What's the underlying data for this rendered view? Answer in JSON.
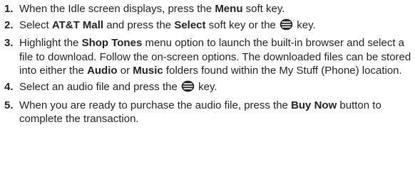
{
  "steps": [
    {
      "number": "1.",
      "t1": "When the Idle screen displays, press the ",
      "b1": "Menu",
      "t2": " soft key."
    },
    {
      "number": "2.",
      "t1": "Select ",
      "b1": "AT&T Mall",
      "t2": " and press the ",
      "b2": "Select",
      "t3": " soft key or the ",
      "icon": "select-key-icon",
      "t4": " key."
    },
    {
      "number": "3.",
      "t1": "Highlight the ",
      "b1": "Shop Tones",
      "t2": " menu option to launch the built-in browser and select a file to download. Follow the on-screen options. The downloaded files can be stored into either the ",
      "b2": "Audio",
      "t3": " or ",
      "b3": "Music",
      "t4": " folders found within the My Stuff (Phone) location."
    },
    {
      "number": "4.",
      "t1": "Select an audio file and press the ",
      "icon": "select-key-icon",
      "t2": " key."
    },
    {
      "number": "5.",
      "t1": "When you are ready to purchase the audio file, press the ",
      "b1": "Buy Now",
      "t2": " button to complete the transaction."
    }
  ]
}
